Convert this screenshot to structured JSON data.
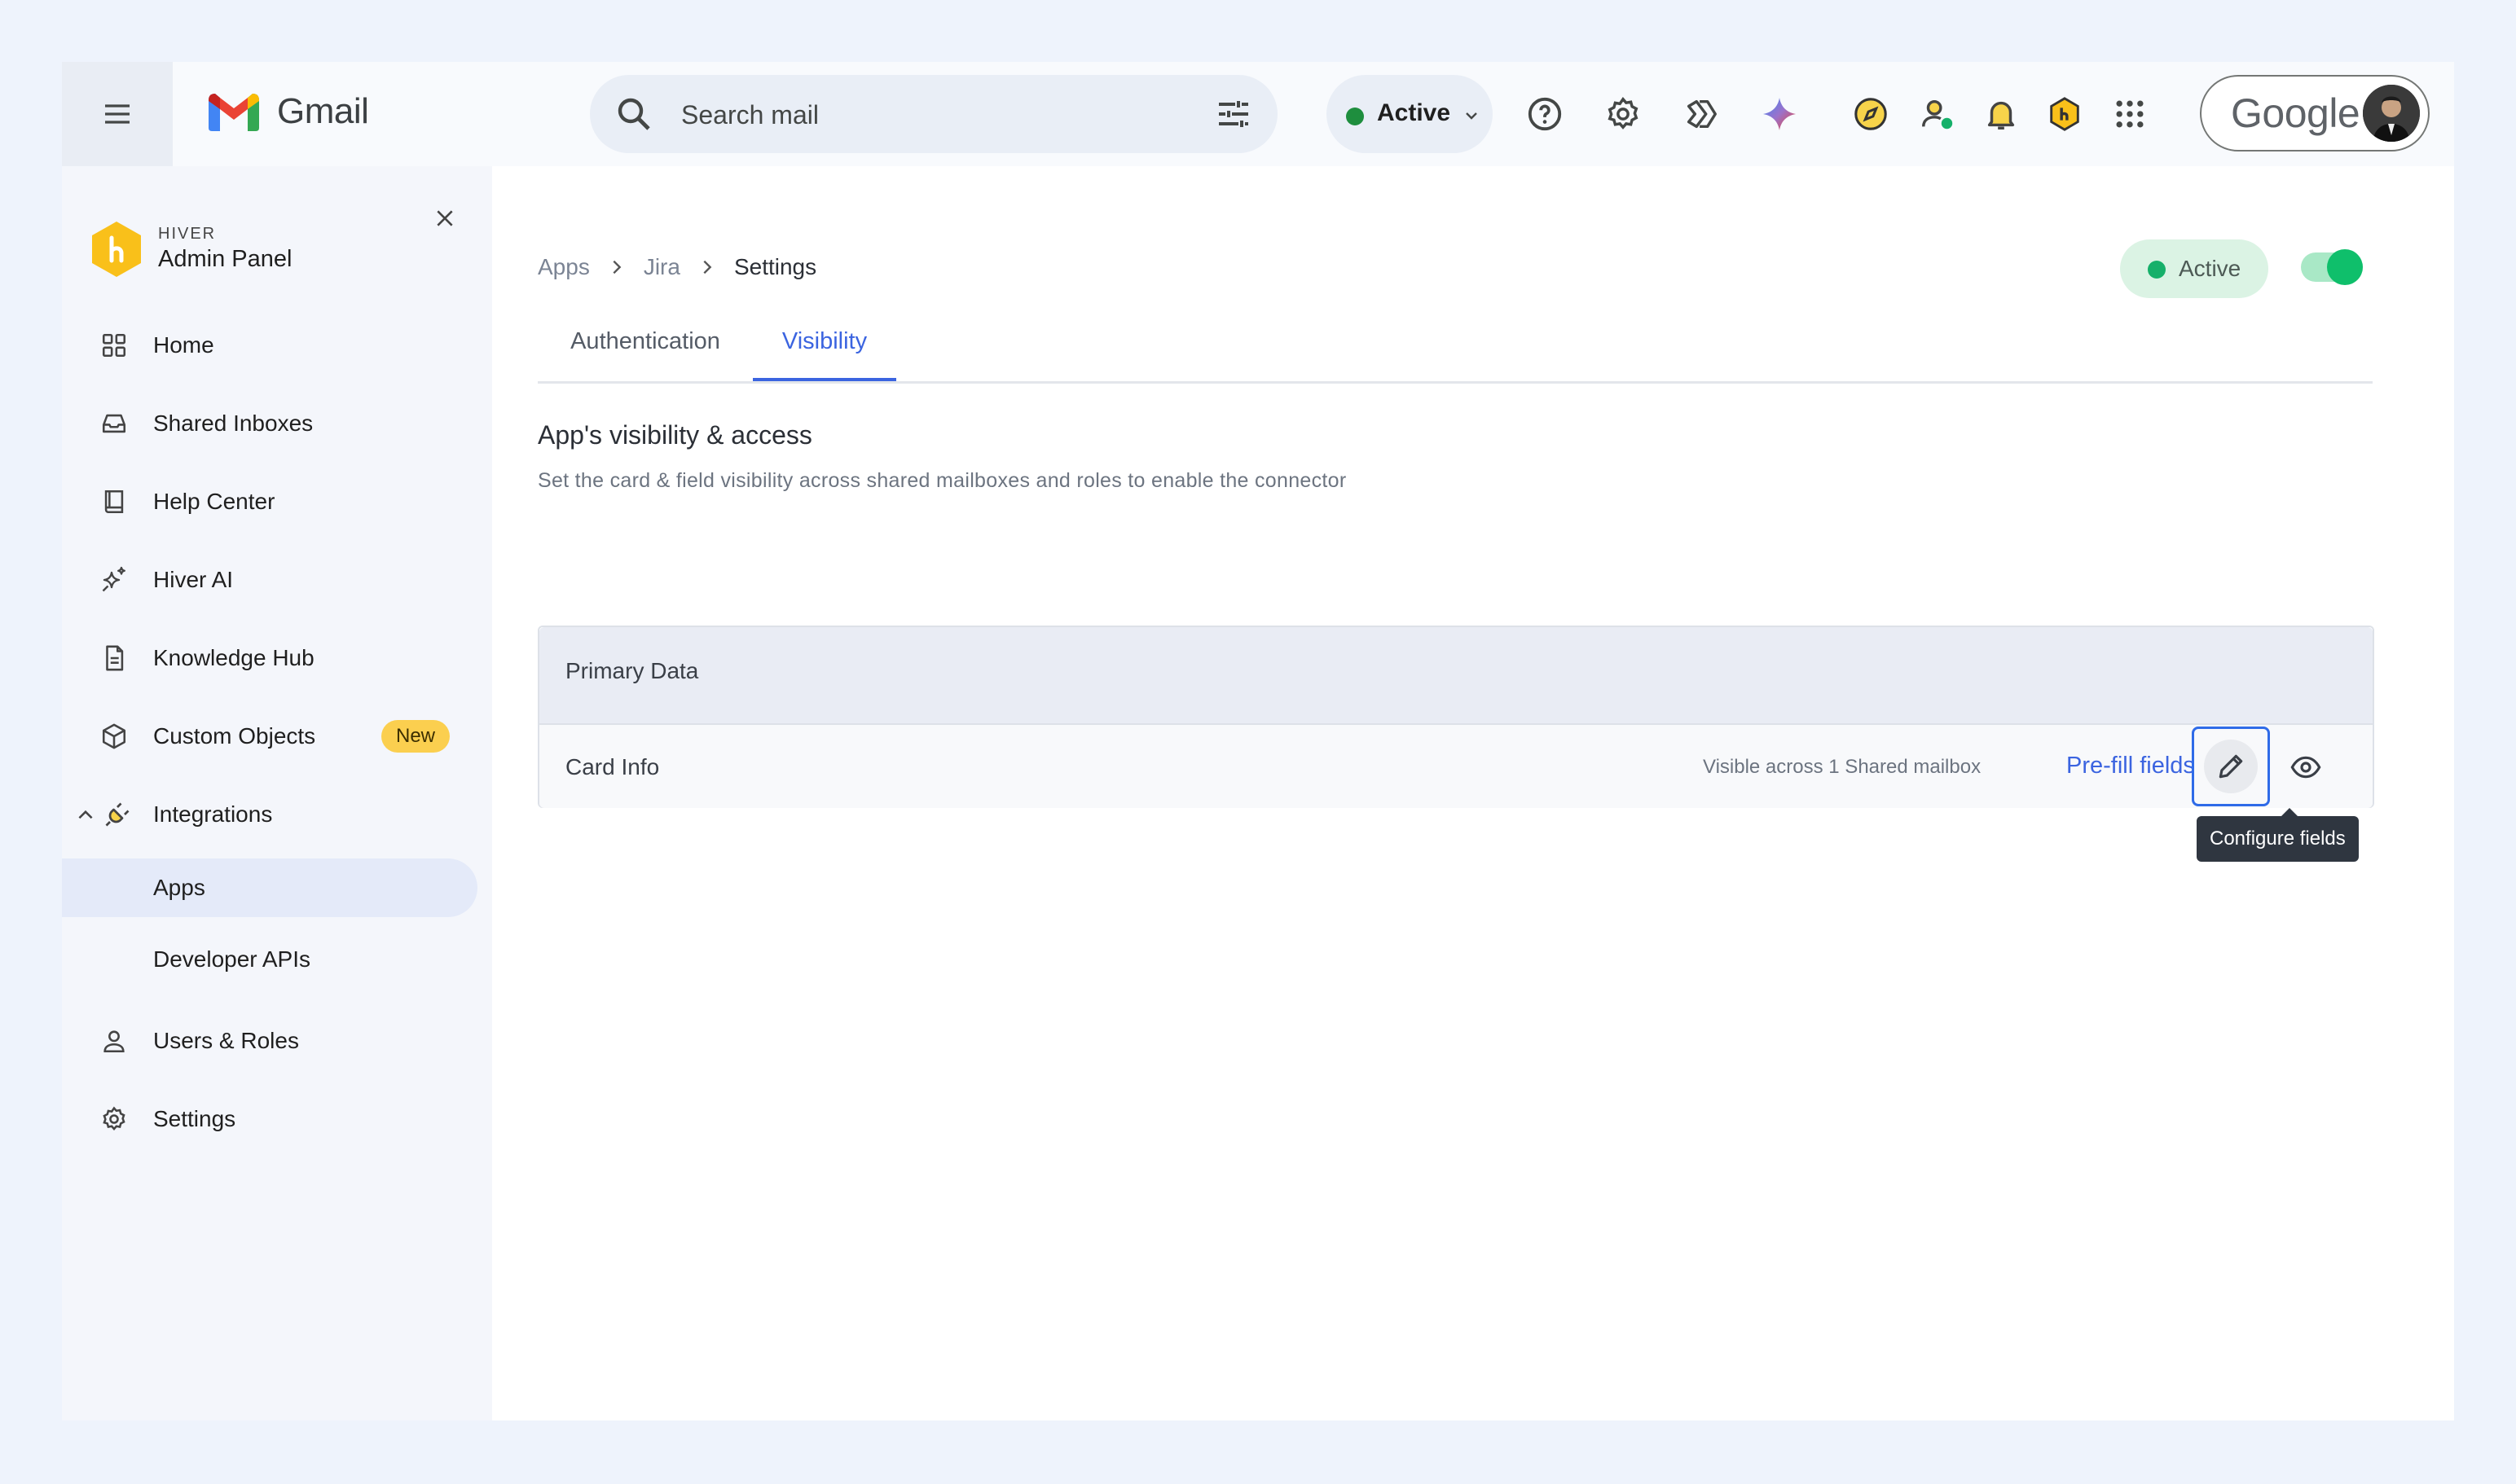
{
  "gmail": {
    "app_name": "Gmail",
    "search_placeholder": "Search mail",
    "status_label": "Active",
    "account_label": "Google"
  },
  "sidebar": {
    "brand_small": "HIVER",
    "brand_title": "Admin Panel",
    "items": [
      {
        "label": "Home",
        "icon": "grid-icon"
      },
      {
        "label": "Shared Inboxes",
        "icon": "inbox-icon"
      },
      {
        "label": "Help Center",
        "icon": "book-icon"
      },
      {
        "label": "Hiver AI",
        "icon": "sparkle-icon"
      },
      {
        "label": "Knowledge Hub",
        "icon": "document-icon"
      },
      {
        "label": "Custom Objects",
        "icon": "cube-icon",
        "badge": "New"
      },
      {
        "label": "Integrations",
        "icon": "plug-icon",
        "expanded": true
      },
      {
        "label": "Apps",
        "selected": true
      },
      {
        "label": "Developer APIs"
      },
      {
        "label": "Users & Roles",
        "icon": "user-icon"
      },
      {
        "label": "Settings",
        "icon": "gear-icon"
      }
    ]
  },
  "breadcrumb": [
    "Apps",
    "Jira",
    "Settings"
  ],
  "app_status": {
    "label": "Active",
    "enabled": true
  },
  "tabs": [
    {
      "label": "Authentication",
      "active": false
    },
    {
      "label": "Visibility",
      "active": true
    }
  ],
  "section": {
    "title": "App's visibility & access",
    "description": "Set the card & field visibility across shared mailboxes and roles to enable the connector"
  },
  "card": {
    "header": "Primary Data",
    "row_label": "Card Info",
    "visibility_text": "Visible across 1 Shared mailbox",
    "prefill_label": "Pre-fill fields",
    "tooltip": "Configure fields"
  },
  "colors": {
    "accent": "#3b64e0",
    "active_green": "#16b06a",
    "badge_yellow": "#fbcf4f",
    "hiver_yellow": "#f9c01a"
  }
}
